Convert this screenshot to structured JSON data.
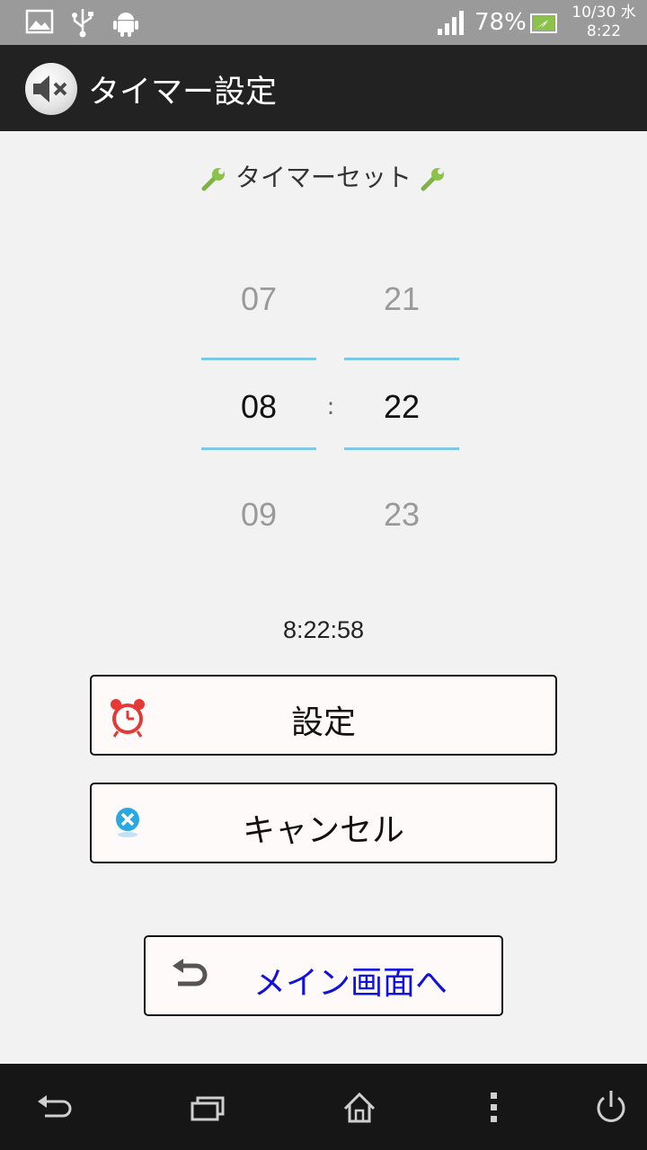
{
  "status_bar": {
    "battery_percent": "78%",
    "date": "10/30 水",
    "time": "8:22",
    "icons": [
      "gallery-icon",
      "usb-icon",
      "android-icon",
      "signal-icon",
      "battery-charging-icon"
    ]
  },
  "app_bar": {
    "title": "タイマー設定",
    "icon": "mute-speaker-icon"
  },
  "timer_set_label": "タイマーセット",
  "picker": {
    "hours": {
      "prev": "07",
      "selected": "08",
      "next": "09"
    },
    "separator": ":",
    "minutes": {
      "prev": "21",
      "selected": "22",
      "next": "23"
    }
  },
  "current_time": "8:22:58",
  "buttons": {
    "set_label": "設定",
    "cancel_label": "キャンセル",
    "main_label": "メイン画面へ"
  },
  "colors": {
    "accent_line": "#7fc8e4",
    "link_blue": "#1111dd",
    "action_bar": "#222222"
  },
  "nav_bar": {
    "icons": [
      "back-icon",
      "recent-apps-icon",
      "home-icon",
      "menu-icon",
      "power-icon"
    ]
  }
}
